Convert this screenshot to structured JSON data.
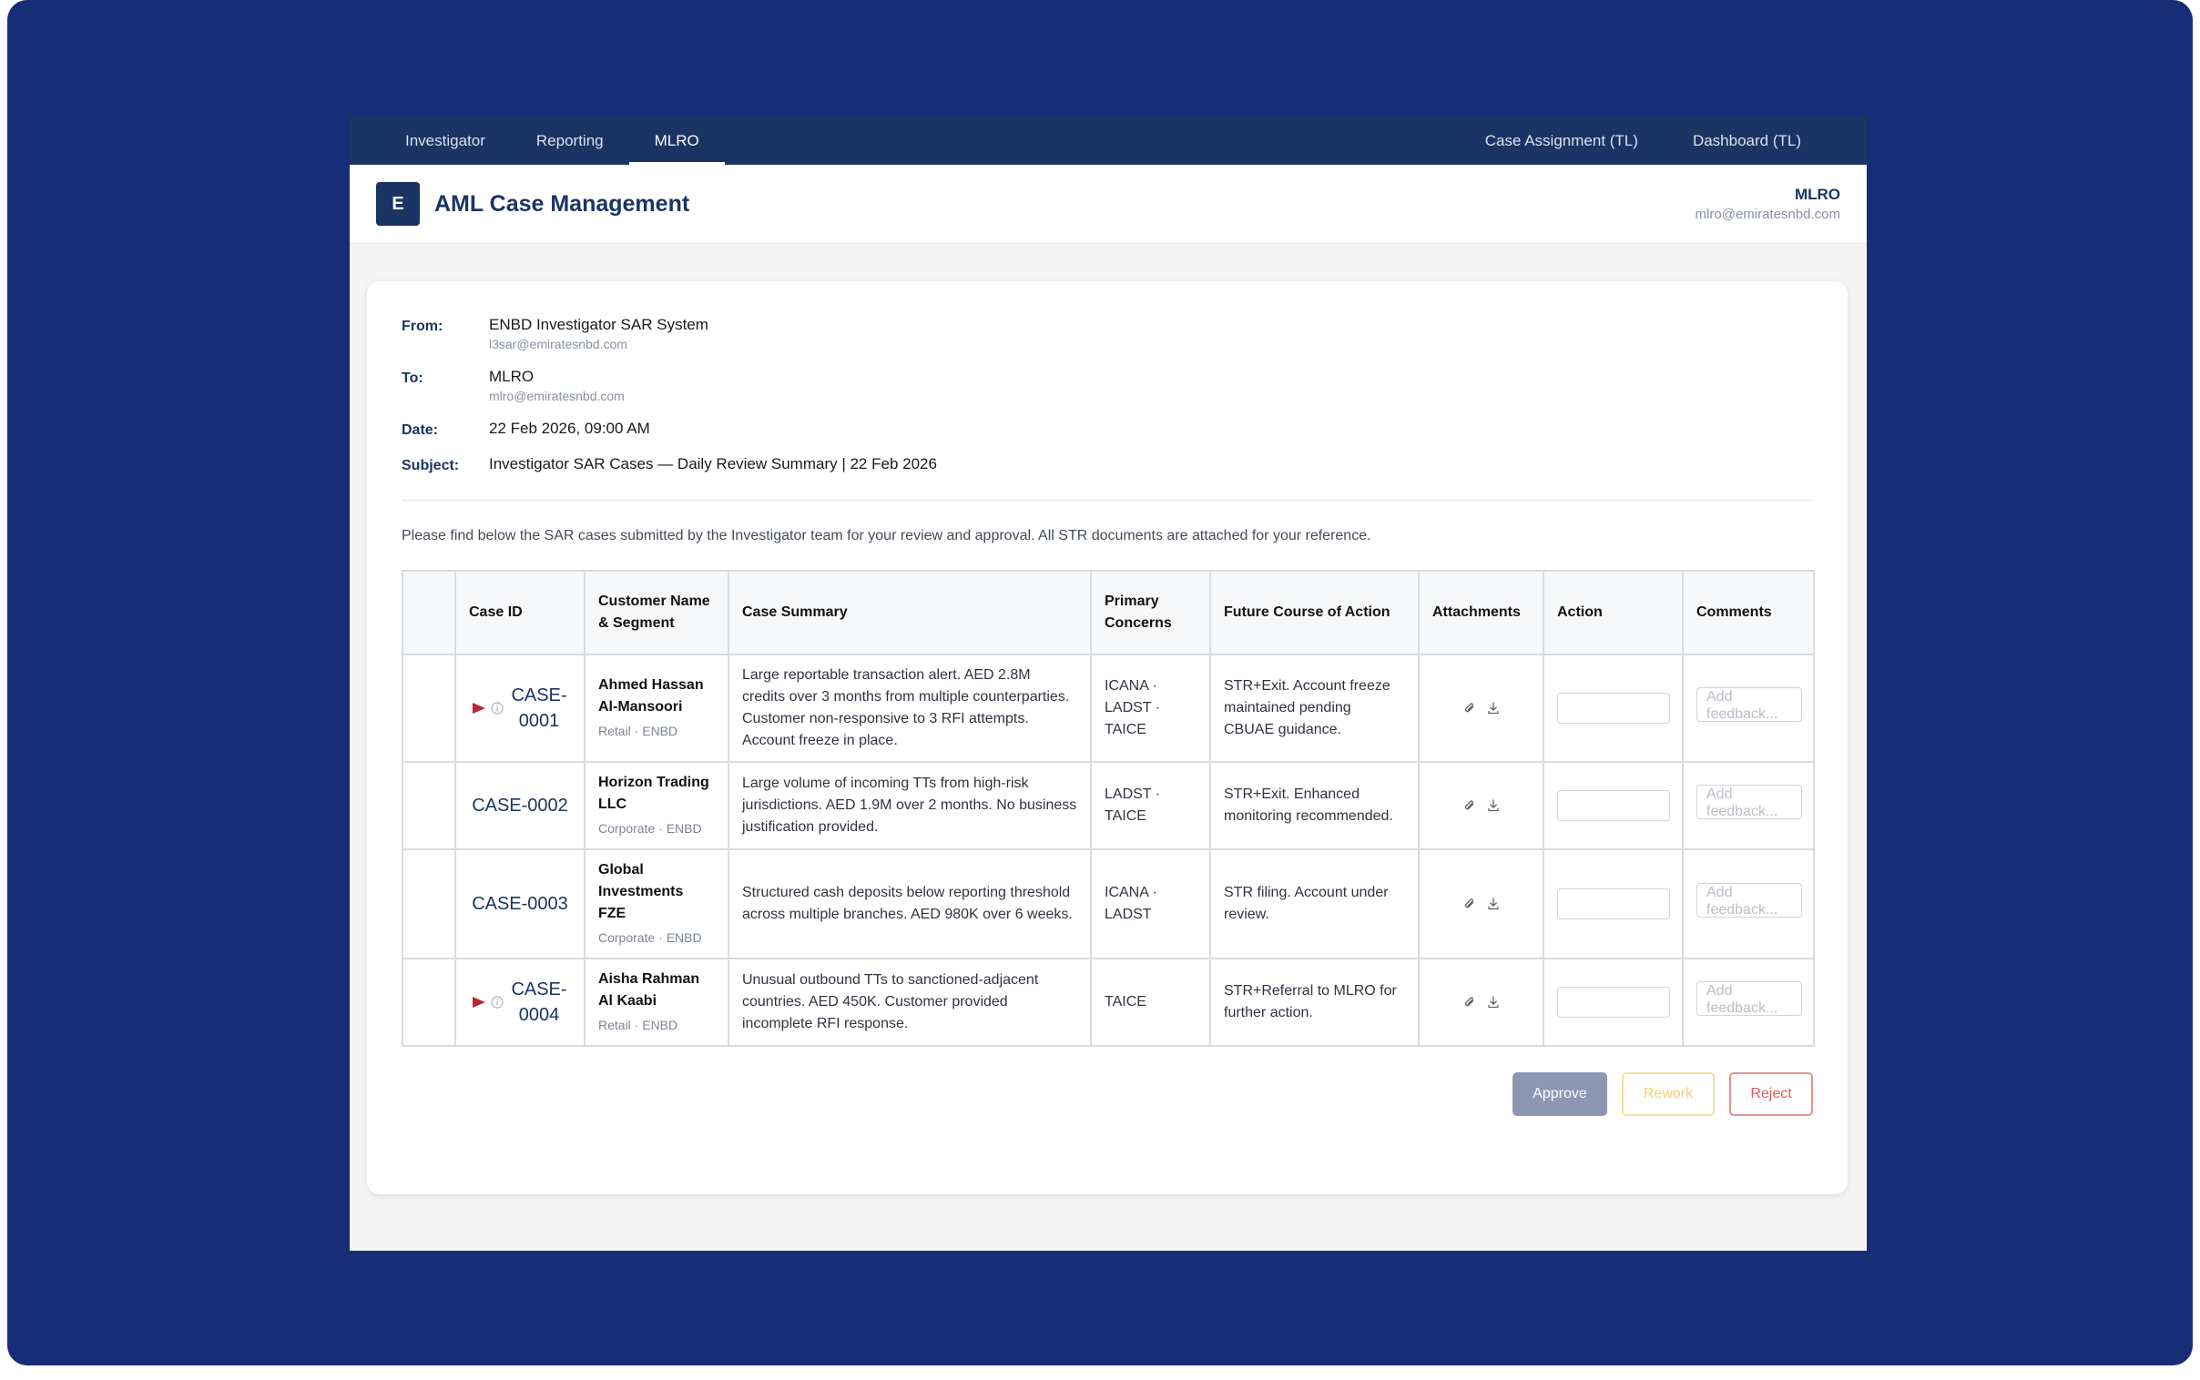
{
  "nav": {
    "left_tabs": [
      "Investigator",
      "Reporting",
      "MLRO"
    ],
    "active_tab": "MLRO",
    "right_tabs": [
      "Case Assignment (TL)",
      "Dashboard (TL)"
    ]
  },
  "header": {
    "logo_letter": "E",
    "title": "AML Case Management",
    "user_role": "MLRO",
    "user_email": "mlro@emiratesnbd.com"
  },
  "email": {
    "from_label": "From:",
    "from_name": "ENBD Investigator SAR System",
    "from_email": "l3sar@emiratesnbd.com",
    "to_label": "To:",
    "to_name": "MLRO",
    "to_email": "mlro@emiratesnbd.com",
    "date_label": "Date:",
    "date_value": "22 Feb 2026, 09:00 AM",
    "subject_label": "Subject:",
    "subject_value": "Investigator SAR Cases — Daily Review Summary | 22 Feb 2026",
    "intro": "Please find below the SAR cases submitted by the Investigator team for your review and approval. All STR documents are attached for your reference."
  },
  "table": {
    "headers": [
      "",
      "Case ID",
      "Customer Name & Segment",
      "Case Summary",
      "Primary Concerns",
      "Future Course of Action",
      "Attachments",
      "Action",
      "Comments"
    ],
    "comment_placeholder": "Add feedback...",
    "rows": [
      {
        "case_id": "CASE-0001",
        "flagged": true,
        "customer": "Ahmed Hassan Al-Mansoori",
        "segment": "Retail · ENBD",
        "summary": "Large reportable transaction alert. AED 2.8M credits over 3 months from multiple counterparties. Customer non-responsive to 3 RFI attempts. Account freeze in place.",
        "concerns": "ICANA · LADST · TAICE",
        "action": "STR+Exit. Account freeze maintained pending CBUAE guidance."
      },
      {
        "case_id": "CASE-0002",
        "flagged": false,
        "customer": "Horizon Trading LLC",
        "segment": "Corporate · ENBD",
        "summary": "Large volume of incoming TTs from high-risk jurisdictions. AED 1.9M over 2 months. No business justification provided.",
        "concerns": "LADST · TAICE",
        "action": "STR+Exit. Enhanced monitoring recommended."
      },
      {
        "case_id": "CASE-0003",
        "flagged": false,
        "customer": "Global Investments FZE",
        "segment": "Corporate · ENBD",
        "summary": "Structured cash deposits below reporting threshold across multiple branches. AED 980K over 6 weeks.",
        "concerns": "ICANA · LADST",
        "action": "STR filing. Account under review."
      },
      {
        "case_id": "CASE-0004",
        "flagged": true,
        "customer": "Aisha Rahman Al Kaabi",
        "segment": "Retail · ENBD",
        "summary": "Unusual outbound TTs to sanctioned-adjacent countries. AED 450K. Customer provided incomplete RFI response.",
        "concerns": "TAICE",
        "action": "STR+Referral to MLRO for further action."
      }
    ]
  },
  "buttons": {
    "approve": "Approve",
    "rework": "Rework",
    "reject": "Reject"
  },
  "colors": {
    "frame_bg": "#172d78",
    "nav_bg": "#1a3463",
    "brand": "#1a3463",
    "flag": "#c0262d",
    "approve_bg": "#8c98b3",
    "rework": "#f5cf7d",
    "reject": "#e05d5d"
  },
  "icons": {
    "flag": "flag-icon",
    "info": "info-icon",
    "attachment": "paperclip-icon",
    "download": "download-icon"
  }
}
